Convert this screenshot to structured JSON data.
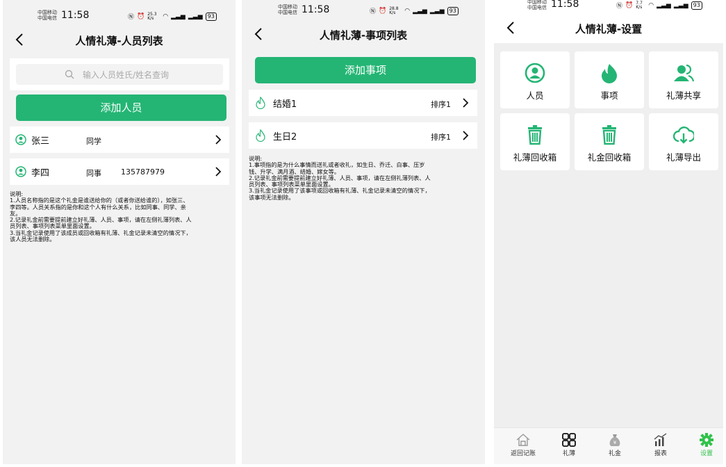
{
  "colors": {
    "accent": "#24b574",
    "active_tab": "#2fc24a"
  },
  "status": {
    "carrier1": "中国移动",
    "carrier2": "中国电信",
    "time": "11:58",
    "speed1": "25.3 K/s",
    "speed2": "28.8 K/s",
    "speed3": "7.7 K/s",
    "battery": "93"
  },
  "screen1": {
    "title": "人情礼薄-人员列表",
    "search_placeholder": "输入人员姓氏/姓名查询",
    "add_button": "添加人员",
    "people": [
      {
        "name": "张三",
        "relation": "同学",
        "phone": ""
      },
      {
        "name": "李四",
        "relation": "同事",
        "phone": "135787979"
      }
    ],
    "note": [
      "说明:",
      "1.人员名称指的是这个礼金是谁送给你的（或者你送给谁的），如张三、",
      "李四等。人员关系指的是你和这个人有什么关系，比如同事、同学、亲",
      "友。",
      "2.记录礼金前需要提前建立好礼薄、人员、事项，请在左侧礼薄列表、人",
      "员列表、事项列表菜单里面设置。",
      "3.当礼金记录使用了该成员或回收箱有礼薄、礼金记录未清空的情况下，",
      "该人员无法删除。"
    ]
  },
  "screen2": {
    "title": "人情礼薄-事项列表",
    "add_button": "添加事项",
    "events": [
      {
        "name": "结婚1",
        "order": "排序1"
      },
      {
        "name": "生日2",
        "order": "排序1"
      }
    ],
    "note": [
      "说明:",
      "1.事项指的是为什么事情而送礼或者收礼，如生日、乔迁、白事、压岁",
      "钱、升学、满月酒、结婚、嫁女等。",
      "2.记录礼金前需要提前建立好礼薄、人员、事项，请在左侧礼薄列表、人",
      "员列表、事项列表菜单里面设置。",
      "3.当礼金记录使用了该事项或回收箱有礼薄、礼金记录未清空的情况下，",
      "该事项无法删除。"
    ]
  },
  "screen3": {
    "title": "人情礼薄-设置",
    "tiles": [
      {
        "label": "人员",
        "icon": "person-icon"
      },
      {
        "label": "事项",
        "icon": "flame-icon"
      },
      {
        "label": "礼薄共享",
        "icon": "share-users-icon"
      },
      {
        "label": "礼薄回收箱",
        "icon": "trash-icon"
      },
      {
        "label": "礼金回收箱",
        "icon": "trash-icon"
      },
      {
        "label": "礼薄导出",
        "icon": "cloud-download-icon"
      }
    ],
    "tabs": [
      {
        "label": "返回记账",
        "icon": "home-icon"
      },
      {
        "label": "礼薄",
        "icon": "grid-icon"
      },
      {
        "label": "礼金",
        "icon": "money-bag-icon"
      },
      {
        "label": "报表",
        "icon": "chart-icon"
      },
      {
        "label": "设置",
        "icon": "gear-icon",
        "active": true
      }
    ]
  }
}
